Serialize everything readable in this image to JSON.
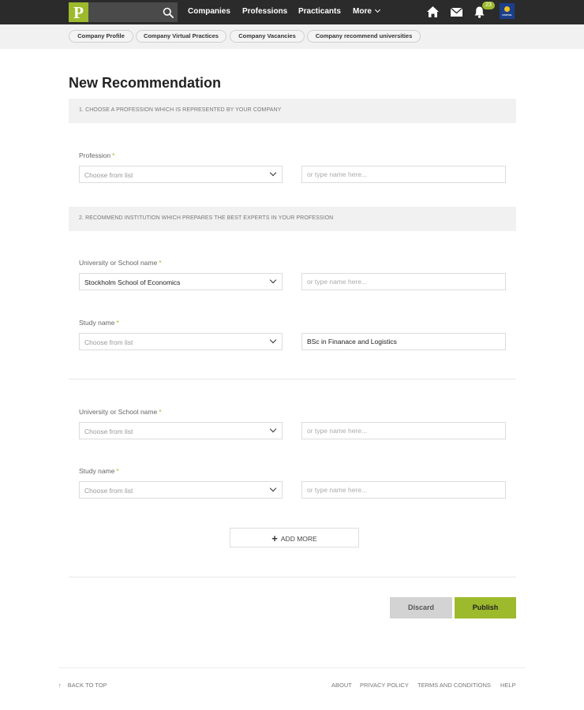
{
  "header": {
    "logo_letter": "P",
    "search": {
      "placeholder": "",
      "icon": "search-icon"
    },
    "nav": [
      "Companies",
      "Professions",
      "Practicants",
      "More"
    ],
    "notification_count": "23",
    "avatar_text": "STATOIL",
    "icons": [
      "home-icon",
      "mail-icon",
      "bell-icon"
    ],
    "accent_color": "#9dba2c"
  },
  "subnav": [
    "Company Profile",
    "Company Virtual Practices",
    "Company Vacancies",
    "Company recommend universities"
  ],
  "page_title": "New Recommendation",
  "sections": {
    "s1": "1. CHOOSE A PROFESSION WHICH IS REPRESENTED BY YOUR COMPANY",
    "s2": "2. RECOMMEND INSTITUTION WHICH PREPARES THE BEST EXPERTS IN YOUR PROFESSION"
  },
  "form": {
    "required_mark": "*",
    "profession": {
      "label": "Profession",
      "select_value": "Choose from list",
      "input_value": "",
      "input_placeholder": "or type name here..."
    },
    "university_1": {
      "label": "University or School name",
      "select_value": "Stockholm School of Economics",
      "input_value": "",
      "input_placeholder": "or type name here..."
    },
    "study_1": {
      "label": "Study name",
      "select_value": "Choose from list",
      "input_value": "BSc in Finanace and Logistics",
      "input_placeholder": "or type name here..."
    },
    "university_2": {
      "label": "University or School name",
      "select_value": "Choose from list",
      "input_value": "",
      "input_placeholder": "or type name here..."
    },
    "study_2": {
      "label": "Study name",
      "select_value": "Choose from list",
      "input_value": "",
      "input_placeholder": "or type name here..."
    }
  },
  "add_more": {
    "icon": "+",
    "label": "ADD MORE"
  },
  "actions": {
    "discard": "Discard",
    "publish": "Publish"
  },
  "footer": {
    "back_to_top_icon": "↑",
    "back_to_top": "BACK TO TOP",
    "links": [
      "ABOUT",
      "PRIVACY POLICY",
      "TERMS AND CONDITIONS",
      "HELP"
    ]
  }
}
